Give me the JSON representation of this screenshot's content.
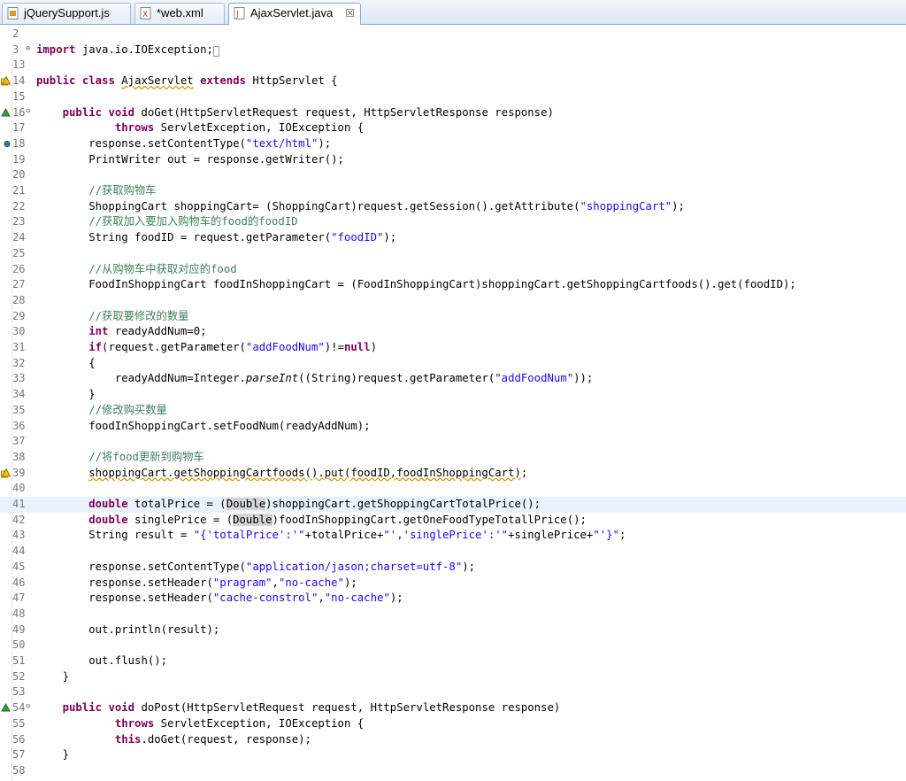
{
  "tabs": [
    {
      "label": "jQuerySupport.js",
      "icon": "js-file-icon",
      "active": false
    },
    {
      "label": "*web.xml",
      "icon": "xml-file-icon",
      "active": false
    },
    {
      "label": "AjaxServlet.java",
      "icon": "java-file-icon",
      "active": true,
      "close": "☒"
    }
  ],
  "lines": [
    {
      "n": "2",
      "html": ""
    },
    {
      "n": "3",
      "fold": "⊕",
      "html": "<span class=\"kw\">import</span> java.io.IOException;<span style=\"border:1px solid #999;font-size:9px\">&nbsp;</span>"
    },
    {
      "n": "13",
      "html": ""
    },
    {
      "n": "14",
      "marker": "warn",
      "html": "<span class=\"kw\">public</span> <span class=\"kw\">class</span> <span class=\"wavy\">AjaxServlet</span> <span class=\"kw\">extends</span> HttpServlet {"
    },
    {
      "n": "15",
      "html": ""
    },
    {
      "n": "16",
      "fold": "⊖",
      "marker": "override",
      "html": "    <span class=\"kw\">public</span> <span class=\"kw\">void</span> doGet(HttpServletRequest request, HttpServletResponse response)"
    },
    {
      "n": "17",
      "html": "            <span class=\"kw\">throws</span> ServletException, IOException {"
    },
    {
      "n": "18",
      "marker": "bp",
      "html": "        response.setContentType(<span class=\"str\">\"text/html\"</span>);"
    },
    {
      "n": "19",
      "html": "        PrintWriter out = response.getWriter();"
    },
    {
      "n": "20",
      "html": ""
    },
    {
      "n": "21",
      "html": "        <span class=\"cm\">//获取购物车</span>"
    },
    {
      "n": "22",
      "html": "        ShoppingCart shoppingCart= (ShoppingCart)request.getSession().getAttribute(<span class=\"str\">\"shoppingCart\"</span>);"
    },
    {
      "n": "23",
      "html": "        <span class=\"cm\">//获取加入要加入购物车的food的foodID</span>"
    },
    {
      "n": "24",
      "html": "        String foodID = request.getParameter(<span class=\"str\">\"foodID\"</span>);"
    },
    {
      "n": "25",
      "html": ""
    },
    {
      "n": "26",
      "html": "        <span class=\"cm\">//从购物车中获取对应的food</span>"
    },
    {
      "n": "27",
      "html": "        FoodInShoppingCart foodInShoppingCart = (FoodInShoppingCart)shoppingCart.getShoppingCartfoods().get(foodID);"
    },
    {
      "n": "28",
      "html": ""
    },
    {
      "n": "29",
      "html": "        <span class=\"cm\">//获取要修改的数量</span>"
    },
    {
      "n": "30",
      "html": "        <span class=\"kw\">int</span> readyAddNum=0;"
    },
    {
      "n": "31",
      "html": "        <span class=\"kw\">if</span>(request.getParameter(<span class=\"str\">\"addFoodNum\"</span>)!=<span class=\"kw\">null</span>)"
    },
    {
      "n": "32",
      "html": "        {"
    },
    {
      "n": "33",
      "html": "            readyAddNum=Integer.<span class=\"it\">parseInt</span>((String)request.getParameter(<span class=\"str\">\"addFoodNum\"</span>));"
    },
    {
      "n": "34",
      "html": "        }"
    },
    {
      "n": "35",
      "html": "        <span class=\"cm\">//修改购买数量</span>"
    },
    {
      "n": "36",
      "html": "        foodInShoppingCart.setFoodNum(readyAddNum);"
    },
    {
      "n": "37",
      "html": ""
    },
    {
      "n": "38",
      "html": "        <span class=\"cm\">//将food更新到购物车</span>"
    },
    {
      "n": "39",
      "marker": "warn",
      "html": "        <span class=\"wavy\">shoppingCart.getShoppingCartfoods().put(foodID,foodInShoppingCart)</span>;"
    },
    {
      "n": "40",
      "html": ""
    },
    {
      "n": "41",
      "current": true,
      "html": "        <span class=\"kw\">double</span> totalPrice = (<span class=\"hl\">Double</span>)shoppingCart.getShoppingCartTotalPrice();"
    },
    {
      "n": "42",
      "html": "        <span class=\"kw\">double</span> singlePrice = (<span class=\"hl\">Double</span>)foodInShoppingCart.getOneFoodTypeTotallPrice();"
    },
    {
      "n": "43",
      "html": "        String result = <span class=\"str\">\"{'totalPrice':'\"</span>+totalPrice+<span class=\"str\">\"','singlePrice':'\"</span>+singlePrice+<span class=\"str\">\"'}\"</span>;"
    },
    {
      "n": "44",
      "html": ""
    },
    {
      "n": "45",
      "html": "        response.setContentType(<span class=\"str\">\"application/jason;charset=utf-8\"</span>);"
    },
    {
      "n": "46",
      "html": "        response.setHeader(<span class=\"str\">\"pragram\"</span>,<span class=\"str\">\"no-cache\"</span>);"
    },
    {
      "n": "47",
      "html": "        response.setHeader(<span class=\"str\">\"cache-constrol\"</span>,<span class=\"str\">\"no-cache\"</span>);"
    },
    {
      "n": "48",
      "html": ""
    },
    {
      "n": "49",
      "html": "        out.println(result);"
    },
    {
      "n": "50",
      "html": ""
    },
    {
      "n": "51",
      "html": "        out.flush();"
    },
    {
      "n": "52",
      "html": "    }"
    },
    {
      "n": "53",
      "html": ""
    },
    {
      "n": "54",
      "fold": "⊖",
      "marker": "override",
      "html": "    <span class=\"kw\">public</span> <span class=\"kw\">void</span> doPost(HttpServletRequest request, HttpServletResponse response)"
    },
    {
      "n": "55",
      "html": "            <span class=\"kw\">throws</span> ServletException, IOException {"
    },
    {
      "n": "56",
      "html": "            <span class=\"kw\">this</span>.doGet(request, response);"
    },
    {
      "n": "57",
      "html": "    }"
    },
    {
      "n": "58",
      "html": ""
    }
  ]
}
